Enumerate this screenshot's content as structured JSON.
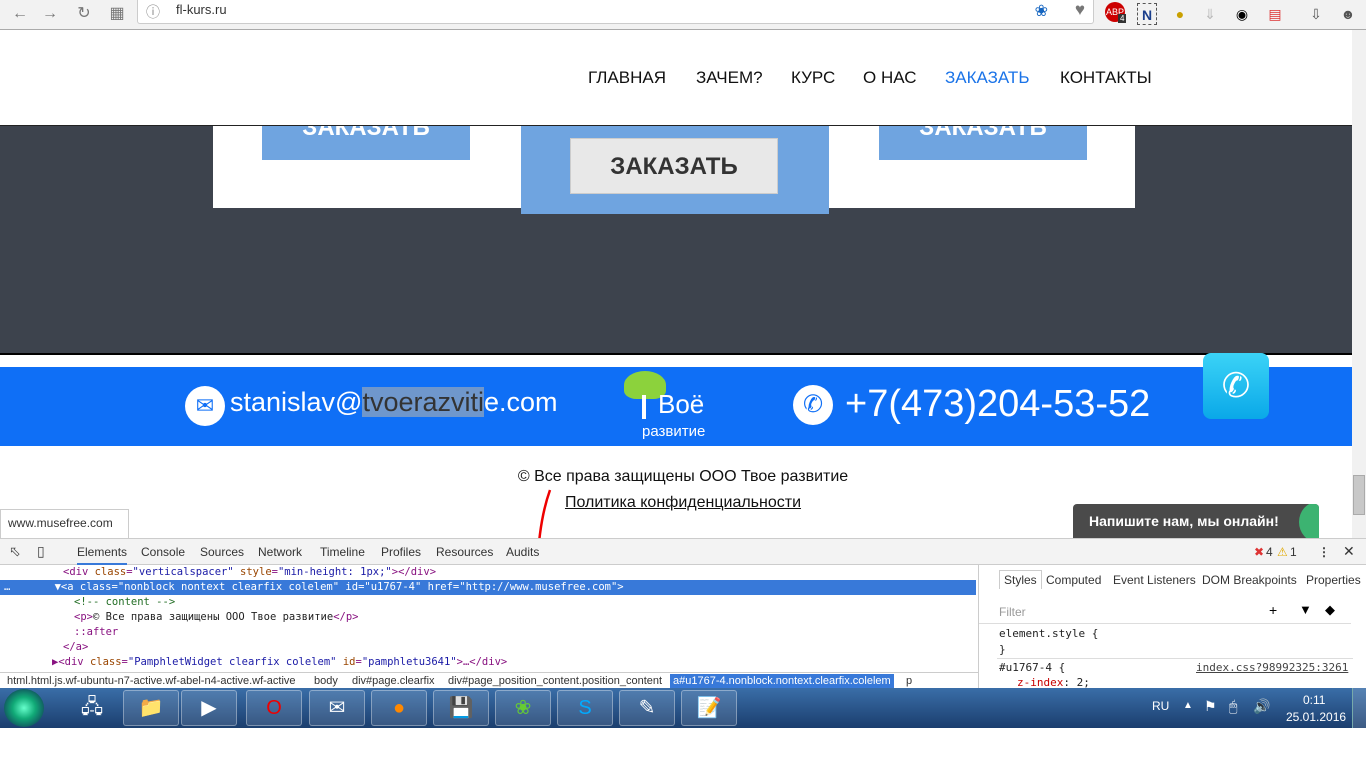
{
  "browser": {
    "url": "fl-kurs.ru",
    "back_icon": "arrow-left",
    "forward_icon": "arrow-right",
    "reload_icon": "reload",
    "apps_icon": "grid",
    "extensions": [
      "abp",
      "n-extension",
      "bee",
      "download-arrow",
      "eye",
      "note",
      "download",
      "account"
    ],
    "abp_badge": "4"
  },
  "nav": {
    "items": [
      "ГЛАВНАЯ",
      "ЗАЧЕМ?",
      "КУРС",
      "О НАС",
      "ЗАКАЗАТЬ",
      "КОНТАКТЫ"
    ],
    "active_index": 4,
    "active_color": "#1a73e8"
  },
  "order": {
    "left_label": "ЗАКАЗАТЬ",
    "center_label": "ЗАКАЗАТЬ",
    "right_label": "ЗАКАЗАТЬ"
  },
  "contact": {
    "email_pre": "stanislav@",
    "email_sel": "tvoerazviti",
    "email_post": "e.com",
    "phone": "+7(473)204-53-52",
    "logo_text": "Твоё развитие",
    "bar_color": "#0f6ff6"
  },
  "footer": {
    "copyright": "© Все права защищены ООО Твое развитие",
    "policy": "Политика конфиденциальности"
  },
  "status_url": "www.musefree.com",
  "chat": {
    "label": "Напишите нам, мы онлайн!"
  },
  "devtools": {
    "tabs": [
      "Elements",
      "Console",
      "Sources",
      "Network",
      "Timeline",
      "Profiles",
      "Resources",
      "Audits"
    ],
    "errors": "4",
    "warnings": "1",
    "tree": {
      "l1": {
        "open": "<div ",
        "a1": "class",
        "v1": "\"verticalspacer\"",
        "a2": "style",
        "v2": "\"min-height: 1px;\"",
        "close": "></div>"
      },
      "l2": {
        "open": "<a ",
        "a1": "class",
        "v1": "\"nonblock nontext clearfix colelem\"",
        "a2": "id",
        "v2": "\"u1767-4\"",
        "a3": "href",
        "v3": "\"http://www.musefree.com\"",
        "close": ">"
      },
      "l3": "<!-- content -->",
      "l4": {
        "open": "<p>",
        "text": "© Все права защищены ООО Твое развитие",
        "close": "</p>"
      },
      "l5": "::after",
      "l6": "</a>",
      "l7": {
        "open": "<div ",
        "a1": "class",
        "v1": "\"PamphletWidget clearfix colelem\"",
        "a2": "id",
        "v2": "\"pamphletu3641\"",
        "close": ">…</div>"
      }
    },
    "crumbs": [
      "html.html.js.wf-ubuntu-n7-active.wf-abel-n4-active.wf-active",
      "body",
      "div#page.clearfix",
      "div#page_position_content.position_content",
      "a#u1767-4.nonblock.nontext.clearfix.colelem",
      "p"
    ],
    "side_tabs": [
      "Styles",
      "Computed",
      "Event Listeners",
      "DOM Breakpoints",
      "Properties"
    ],
    "filter_placeholder": "Filter",
    "rules": {
      "r1_open": "element.style {",
      "r1_close": "}",
      "r2_sel": "#u1767-4 {",
      "r2_src": "index.css?98992325:3261",
      "r2_prop": "z-index",
      "r2_val": "2;"
    }
  },
  "taskbar": {
    "lang": "RU",
    "time": "0:11",
    "date": "25.01.2016"
  }
}
